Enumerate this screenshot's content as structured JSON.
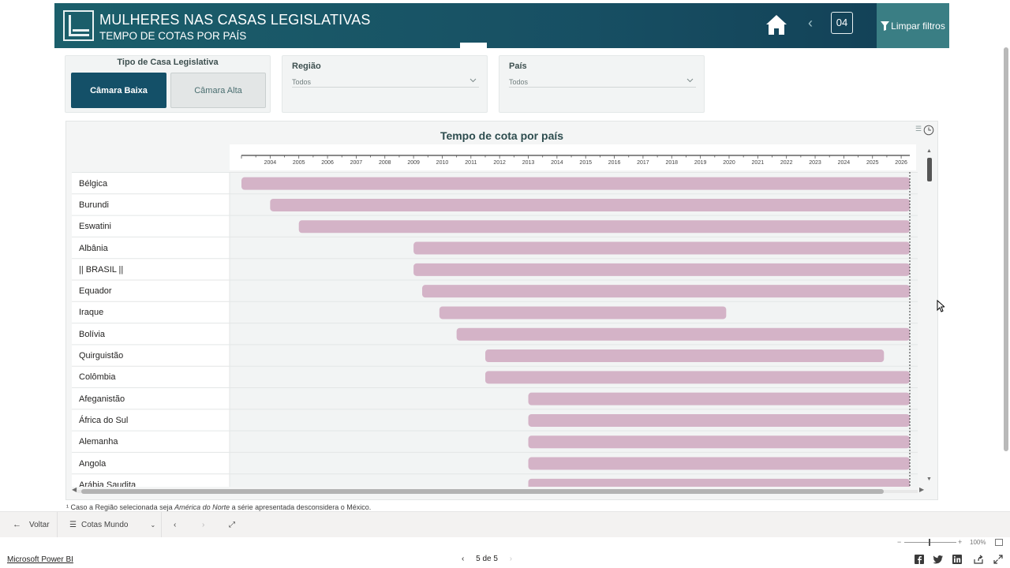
{
  "header": {
    "title": "MULHERES NAS CASAS LEGISLATIVAS",
    "subtitle": "TEMPO DE COTAS POR PAÍS",
    "page_number": "04",
    "clear_filters": "Limpar filtros"
  },
  "slicers": {
    "tipo": {
      "title": "Tipo de Casa Legislativa",
      "options": [
        "Câmara Baixa",
        "Câmara Alta"
      ],
      "selected": "Câmara Baixa"
    },
    "regiao": {
      "title": "Região",
      "value": "Todos"
    },
    "pais": {
      "title": "País",
      "value": "Todos"
    }
  },
  "chart_data": {
    "type": "bar",
    "title": "Tempo de cota por país",
    "x_ticks": [
      "2004",
      "2005",
      "2006",
      "2007",
      "2008",
      "2009",
      "2010",
      "2011",
      "2012",
      "2013",
      "2014",
      "2015",
      "2016",
      "2017",
      "2018",
      "2019",
      "2020",
      "2021",
      "2022",
      "2023",
      "2024",
      "2025",
      "2026"
    ],
    "xlim": [
      2003,
      2026.3
    ],
    "series": [
      {
        "name": "Bélgica",
        "start": 2003.0,
        "end": 2026.3
      },
      {
        "name": "Burundi",
        "start": 2004.0,
        "end": 2026.3
      },
      {
        "name": "Eswatini",
        "start": 2005.0,
        "end": 2026.3
      },
      {
        "name": "Albânia",
        "start": 2009.0,
        "end": 2026.3
      },
      {
        "name": "|| BRASIL ||",
        "start": 2009.0,
        "end": 2026.3
      },
      {
        "name": "Equador",
        "start": 2009.3,
        "end": 2026.3
      },
      {
        "name": "Iraque",
        "start": 2009.9,
        "end": 2019.9
      },
      {
        "name": "Bolívia",
        "start": 2010.5,
        "end": 2026.3
      },
      {
        "name": "Quirguistão",
        "start": 2011.5,
        "end": 2025.4
      },
      {
        "name": "Colômbia",
        "start": 2011.5,
        "end": 2026.3
      },
      {
        "name": "Afeganistão",
        "start": 2013.0,
        "end": 2026.3
      },
      {
        "name": "África do Sul",
        "start": 2013.0,
        "end": 2026.3
      },
      {
        "name": "Alemanha",
        "start": 2013.0,
        "end": 2026.3
      },
      {
        "name": "Angola",
        "start": 2013.0,
        "end": 2026.3
      },
      {
        "name": "Arábia Saudita",
        "start": 2013.0,
        "end": 2026.3
      }
    ],
    "bar_color": "#d4b3c7"
  },
  "footnote": {
    "prefix": "¹ Caso a Região selecionada seja ",
    "emphasis": "América do Norte",
    "suffix": " a série apresentada desconsidera o México."
  },
  "bottom_nav": {
    "back": "Voltar",
    "pages": "Cotas Mundo"
  },
  "status_bar": {
    "brand_link": "Microsoft Power BI",
    "pager": "5 de 5",
    "zoom": "100%"
  }
}
